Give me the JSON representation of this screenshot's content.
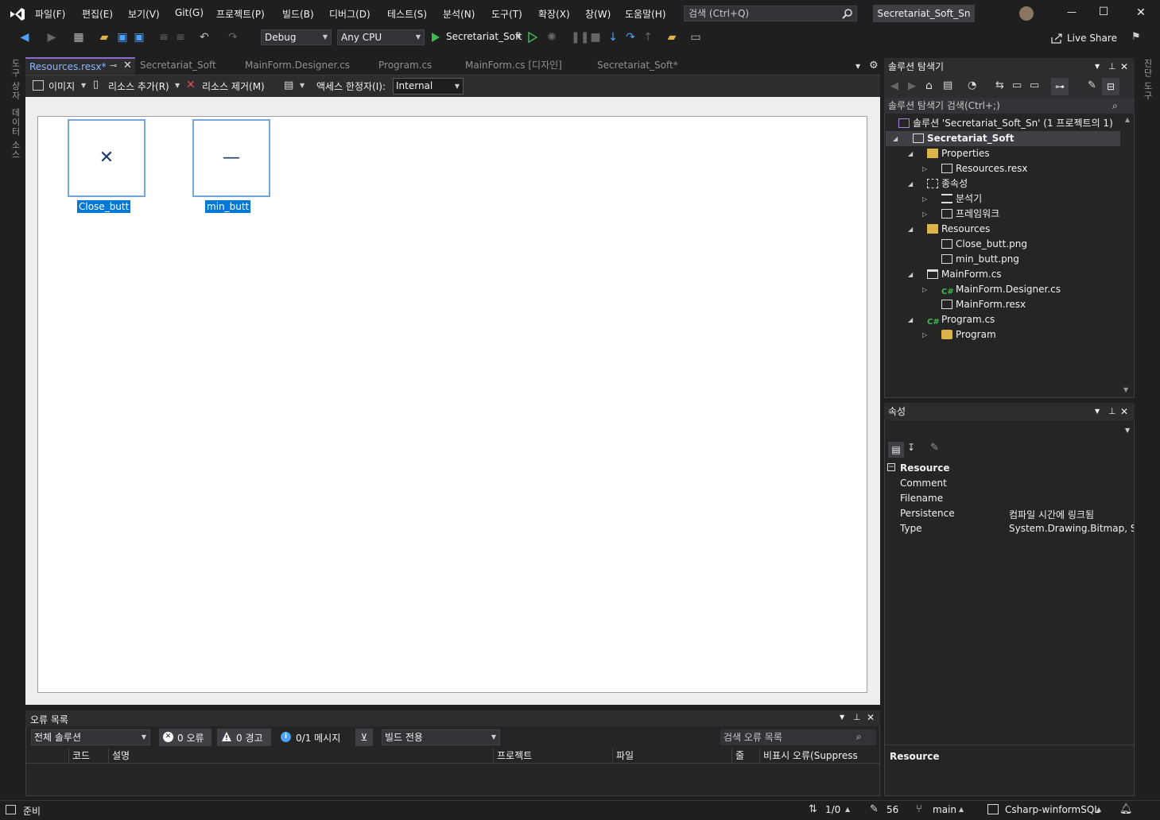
{
  "menu": {
    "items": [
      "파일(F)",
      "편집(E)",
      "보기(V)",
      "Git(G)",
      "프로젝트(P)",
      "빌드(B)",
      "디버그(D)",
      "테스트(S)",
      "분석(N)",
      "도구(T)",
      "확장(X)",
      "창(W)",
      "도움말(H)"
    ]
  },
  "search": {
    "placeholder": "검색 (Ctrl+Q)"
  },
  "window": {
    "solution_name": "Secretariat_Soft_Sn",
    "minimize": "—",
    "maximize": "☐",
    "close": "✕"
  },
  "toolbar": {
    "config": "Debug",
    "platform": "Any CPU",
    "run_target": "Secretariat_Soft",
    "live_share": "Live Share"
  },
  "left_strip": {
    "toolbox": "도구 상자",
    "datasources": "데이터 소스"
  },
  "right_strip": {
    "label": "진단 도구"
  },
  "doc_tabs": [
    {
      "label": "Resources.resx*"
    },
    {
      "label": "Secretariat_Soft"
    },
    {
      "label": "MainForm.Designer.cs"
    },
    {
      "label": "Program.cs"
    },
    {
      "label": "MainForm.cs [디자인]"
    },
    {
      "label": "Secretariat_Soft*"
    }
  ],
  "resx_toolbar": {
    "images": "이미지",
    "add_resource": "리소스 추가(R)",
    "remove_resource": "리소스 제거(M)",
    "access_label": "액세스 한정자(I):",
    "access_value": "Internal"
  },
  "resources": [
    {
      "name": "Close_butt",
      "glyph": "✕"
    },
    {
      "name": "min_butt",
      "glyph": "—"
    }
  ],
  "error_list": {
    "title": "오류 목록",
    "scope": "전체 솔루션",
    "errors": "0 오류",
    "warnings": "0 경고",
    "messages": "0/1 메시지",
    "build_filter": "빌드 전용",
    "search_placeholder": "검색 오류 목록",
    "columns": [
      "코드",
      "설명",
      "프로젝트",
      "파일",
      "줄",
      "비표시 오류(Suppress"
    ]
  },
  "solution_explorer": {
    "title": "솔루션 탐색기",
    "search_placeholder": "솔루션 탐색기 검색(Ctrl+;)",
    "tree": [
      {
        "label": "솔루션 'Secretariat_Soft_Sn' (1 프로젝트의 1)",
        "icon": "solution-icon"
      },
      {
        "label": "Secretariat_Soft",
        "icon": "csharp-project-icon"
      },
      {
        "label": "Properties",
        "icon": "properties-folder-icon"
      },
      {
        "label": "Resources.resx",
        "icon": "resx-file-icon"
      },
      {
        "label": "종속성",
        "icon": "dependencies-icon"
      },
      {
        "label": "분석기",
        "icon": "analyzer-icon"
      },
      {
        "label": "프레임워크",
        "icon": "framework-icon"
      },
      {
        "label": "Resources",
        "icon": "folder-icon"
      },
      {
        "label": "Close_butt.png",
        "icon": "image-file-icon"
      },
      {
        "label": "min_butt.png",
        "icon": "image-file-icon"
      },
      {
        "label": "MainForm.cs",
        "icon": "form-file-icon"
      },
      {
        "label": "MainForm.Designer.cs",
        "icon": "csharp-file-icon"
      },
      {
        "label": "MainForm.resx",
        "icon": "resx-file-icon"
      },
      {
        "label": "Program.cs",
        "icon": "csharp-file-icon"
      },
      {
        "label": "Program",
        "icon": "class-icon"
      }
    ]
  },
  "properties": {
    "title": "속성",
    "category": "Resource",
    "rows": [
      {
        "name": "Comment",
        "value": ""
      },
      {
        "name": "Filename",
        "value": ""
      },
      {
        "name": "Persistence",
        "value": "컴파일 시간에 링크됨"
      },
      {
        "name": "Type",
        "value": "System.Drawing.Bitmap, Syst"
      }
    ],
    "description_title": "Resource"
  },
  "status": {
    "ready": "준비",
    "line": "1/0",
    "edits": "56",
    "branch": "main",
    "repo": "Csharp-winformSQL"
  },
  "colors": {
    "accent": "#0078d7",
    "purple": "#8a6bd1"
  }
}
